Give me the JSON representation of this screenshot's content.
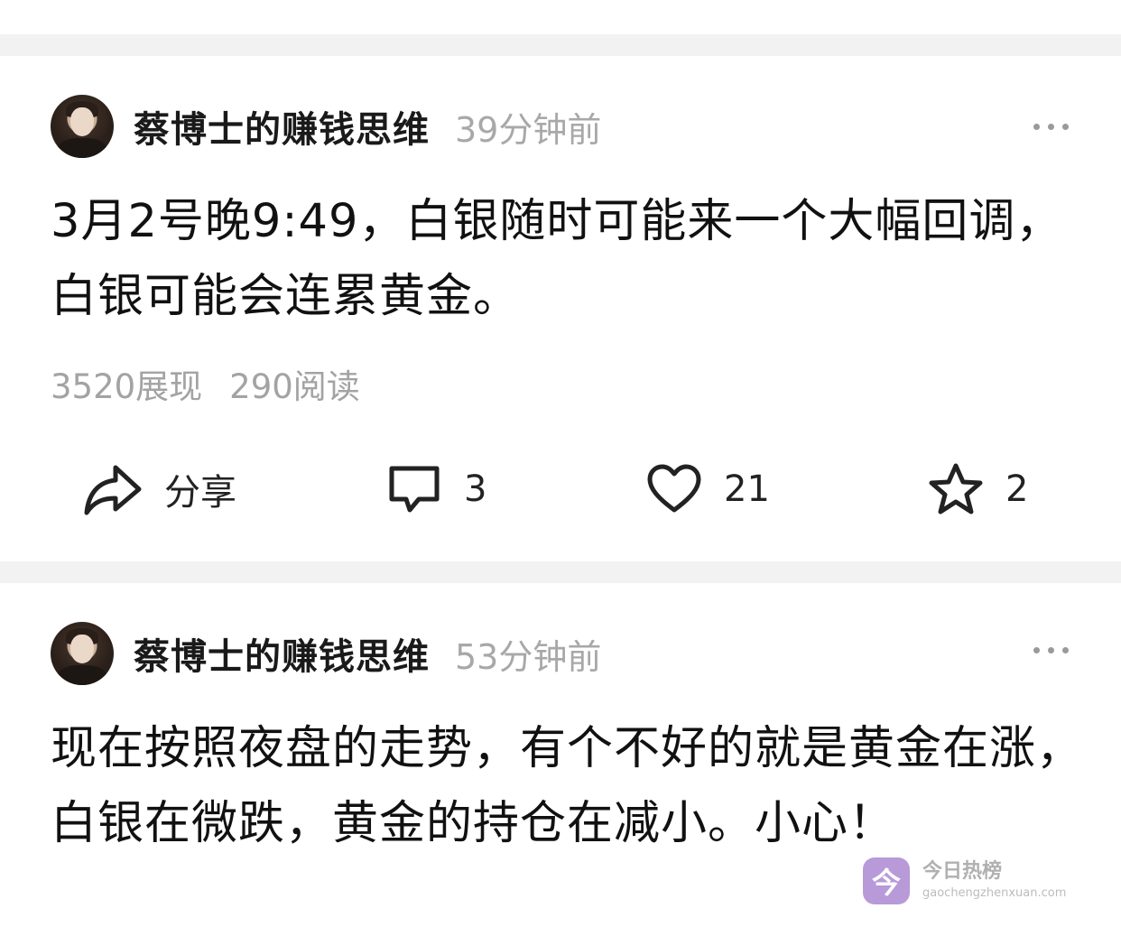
{
  "posts": [
    {
      "author": "蔡博士的赚钱思维",
      "time": "39分钟前",
      "content": "3月2号晚9:49，白银随时可能来一个大幅回调，白银可能会连累黄金。",
      "stats": {
        "impressions": "3520展现",
        "reads": "290阅读"
      },
      "actions": {
        "share_label": "分享",
        "comments": "3",
        "likes": "21",
        "favorites": "2"
      }
    },
    {
      "author": "蔡博士的赚钱思维",
      "time": "53分钟前",
      "content": "现在按照夜盘的走势，有个不好的就是黄金在涨，白银在微跌，黄金的持仓在减小。小心！"
    }
  ],
  "watermark": {
    "logo_char": "今",
    "title": "今日热榜",
    "url": "gaochengzhenxuan.com"
  },
  "colors": {
    "separator": "#f2f2f2",
    "muted_text": "#a8a8a8",
    "watermark_logo": "#b89ad9"
  },
  "icons": [
    "avatar",
    "more-icon",
    "share-icon",
    "comment-icon",
    "heart-icon",
    "star-icon"
  ]
}
